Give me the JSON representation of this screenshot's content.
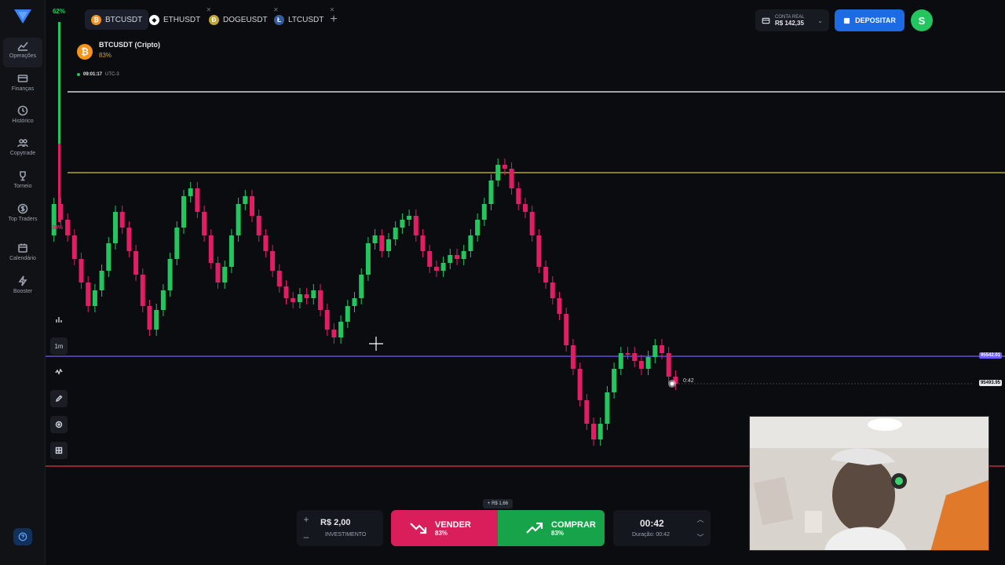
{
  "sidebar": {
    "items": [
      {
        "label": "Operações",
        "icon": "chart-line-icon"
      },
      {
        "label": "Finanças",
        "icon": "wallet-icon"
      },
      {
        "label": "Histórico",
        "icon": "history-icon"
      },
      {
        "label": "Copytrade",
        "icon": "users-icon"
      },
      {
        "label": "Torneio",
        "icon": "trophy-icon"
      },
      {
        "label": "Top Traders",
        "icon": "dollar-icon"
      },
      {
        "label": "Calendário",
        "icon": "calendar-icon"
      },
      {
        "label": "Booster",
        "icon": "lightning-icon"
      }
    ]
  },
  "sentiment": {
    "up_pct": "62%",
    "down_pct": "38%"
  },
  "tabs": [
    {
      "label": "BTCUSDT",
      "icon": "bitcoin-icon",
      "color": "#f7931a",
      "glyph": "₿"
    },
    {
      "label": "ETHUSDT",
      "icon": "ethereum-icon",
      "color": "#ffffff",
      "glyph": "◆"
    },
    {
      "label": "DOGEUSDT",
      "icon": "dogecoin-icon",
      "color": "#c2a633",
      "glyph": "Ð"
    },
    {
      "label": "LTCUSDT",
      "icon": "litecoin-icon",
      "color": "#345d9d",
      "glyph": "Ł"
    }
  ],
  "account": {
    "label": "CONTA REAL",
    "balance": "R$ 142,35"
  },
  "deposit_label": "DEPOSITAR",
  "avatar_letter": "S",
  "asset": {
    "name": "BTCUSDT (Cripto)",
    "payout": "83%"
  },
  "clock": {
    "time": "09:01:17",
    "tz": "UTC-3"
  },
  "timeframe": "1m",
  "price_tags": {
    "current": "95493.95",
    "purple": "95542.01",
    "countdown": "0:42"
  },
  "invest": {
    "value": "R$ 2,00",
    "label": "INVESTIMENTO"
  },
  "profit_tip": "+ R$ 1,66",
  "sell": {
    "label": "VENDER",
    "pct": "83%"
  },
  "buy": {
    "label": "COMPRAR",
    "pct": "83%"
  },
  "duration": {
    "value": "00:42",
    "label": "Duração: 00:42"
  },
  "colors": {
    "up": "#22c55e",
    "down": "#e11d63",
    "accent": "#1d6ae5",
    "line_white": "#ffffff",
    "line_yellow": "#d4c42a",
    "line_purple": "#6d5dfc",
    "line_red": "#e0354b"
  }
}
